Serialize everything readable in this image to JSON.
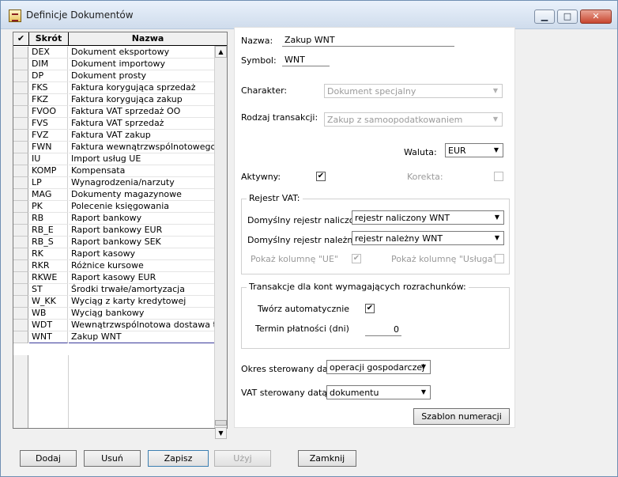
{
  "window": {
    "title": "Definicje Dokumentów"
  },
  "titlebar_buttons": [
    "minimize-icon",
    "maximize-icon",
    "close-icon"
  ],
  "list": {
    "header": {
      "check_icon": "✔",
      "col_code": "Skrót",
      "col_name": "Nazwa"
    },
    "rows": [
      {
        "code": "DEX",
        "name": "Dokument eksportowy"
      },
      {
        "code": "DIM",
        "name": "Dokument importowy"
      },
      {
        "code": "DP",
        "name": "Dokument prosty"
      },
      {
        "code": "FKS",
        "name": "Faktura korygująca sprzedaż"
      },
      {
        "code": "FKZ",
        "name": "Faktura korygująca zakup"
      },
      {
        "code": "FVOO",
        "name": "Faktura VAT sprzedaż OO"
      },
      {
        "code": "FVS",
        "name": "Faktura VAT sprzedaż"
      },
      {
        "code": "FVZ",
        "name": "Faktura VAT zakup"
      },
      {
        "code": "FWN",
        "name": "Faktura wewnątrzwspólnotowego na"
      },
      {
        "code": "IU",
        "name": "Import usług UE"
      },
      {
        "code": "KOMP",
        "name": "Kompensata"
      },
      {
        "code": "LP",
        "name": "Wynagrodzenia/narzuty"
      },
      {
        "code": "MAG",
        "name": "Dokumenty magazynowe"
      },
      {
        "code": "PK",
        "name": "Polecenie księgowania"
      },
      {
        "code": "RB",
        "name": "Raport bankowy"
      },
      {
        "code": "RB_E",
        "name": "Raport bankowy EUR"
      },
      {
        "code": "RB_S",
        "name": "Raport bankowy SEK"
      },
      {
        "code": "RK",
        "name": "Raport kasowy"
      },
      {
        "code": "RKR",
        "name": "Różnice kursowe"
      },
      {
        "code": "RKWE",
        "name": "Raport kasowy EUR"
      },
      {
        "code": "ST",
        "name": "Środki trwałe/amortyzacja"
      },
      {
        "code": "W_KK",
        "name": "Wyciąg z karty kredytowej"
      },
      {
        "code": "WB",
        "name": "Wyciąg bankowy"
      },
      {
        "code": "WDT",
        "name": "Wewnątrzwspólnotowa dostawa tow"
      },
      {
        "code": "WNT",
        "name": "Zakup WNT"
      }
    ],
    "selected_code": "WNT"
  },
  "form": {
    "name_label": "Nazwa:",
    "name_value": "Zakup WNT",
    "symbol_label": "Symbol:",
    "symbol_value": "WNT",
    "charakter_label": "Charakter:",
    "charakter_value": "Dokument specjalny",
    "rodzaj_label": "Rodzaj transakcji:",
    "rodzaj_value": "Zakup z samoopodatkowaniem",
    "waluta_label": "Waluta:",
    "waluta_value": "EUR",
    "aktywny_label": "Aktywny:",
    "aktywny_checked": true,
    "korekta_label": "Korekta:",
    "korekta_checked": false,
    "vat_group_title": "Rejestr VAT:",
    "naliczony_label": "Domyślny rejestr naliczony:",
    "naliczony_value": "rejestr naliczony WNT",
    "nalezny_label": "Domyślny rejestr należny:",
    "nalezny_value": "rejestr należny WNT",
    "kolumna_ue_label": "Pokaż kolumnę \"UE\"",
    "kolumna_ue_checked": true,
    "kolumna_usluga_label": "Pokaż kolumnę \"Usługa\"",
    "kolumna_usluga_checked": false,
    "trans_group_title": "Transakcje dla kont wymagających rozrachunków:",
    "tworz_label": "Twórz automatycznie",
    "tworz_checked": true,
    "termin_label": "Termin płatności (dni)",
    "termin_value": "0",
    "okres_label": "Okres sterowany datą:",
    "okres_value": "operacji gospodarczej",
    "vat_data_label": "VAT sterowany datą:",
    "vat_data_value": "dokumentu",
    "szablon_button": "Szablon numeracji"
  },
  "buttons": {
    "dodaj": "Dodaj",
    "usun": "Usuń",
    "zapisz": "Zapisz",
    "uzyj": "Użyj",
    "zamknij": "Zamknij"
  }
}
